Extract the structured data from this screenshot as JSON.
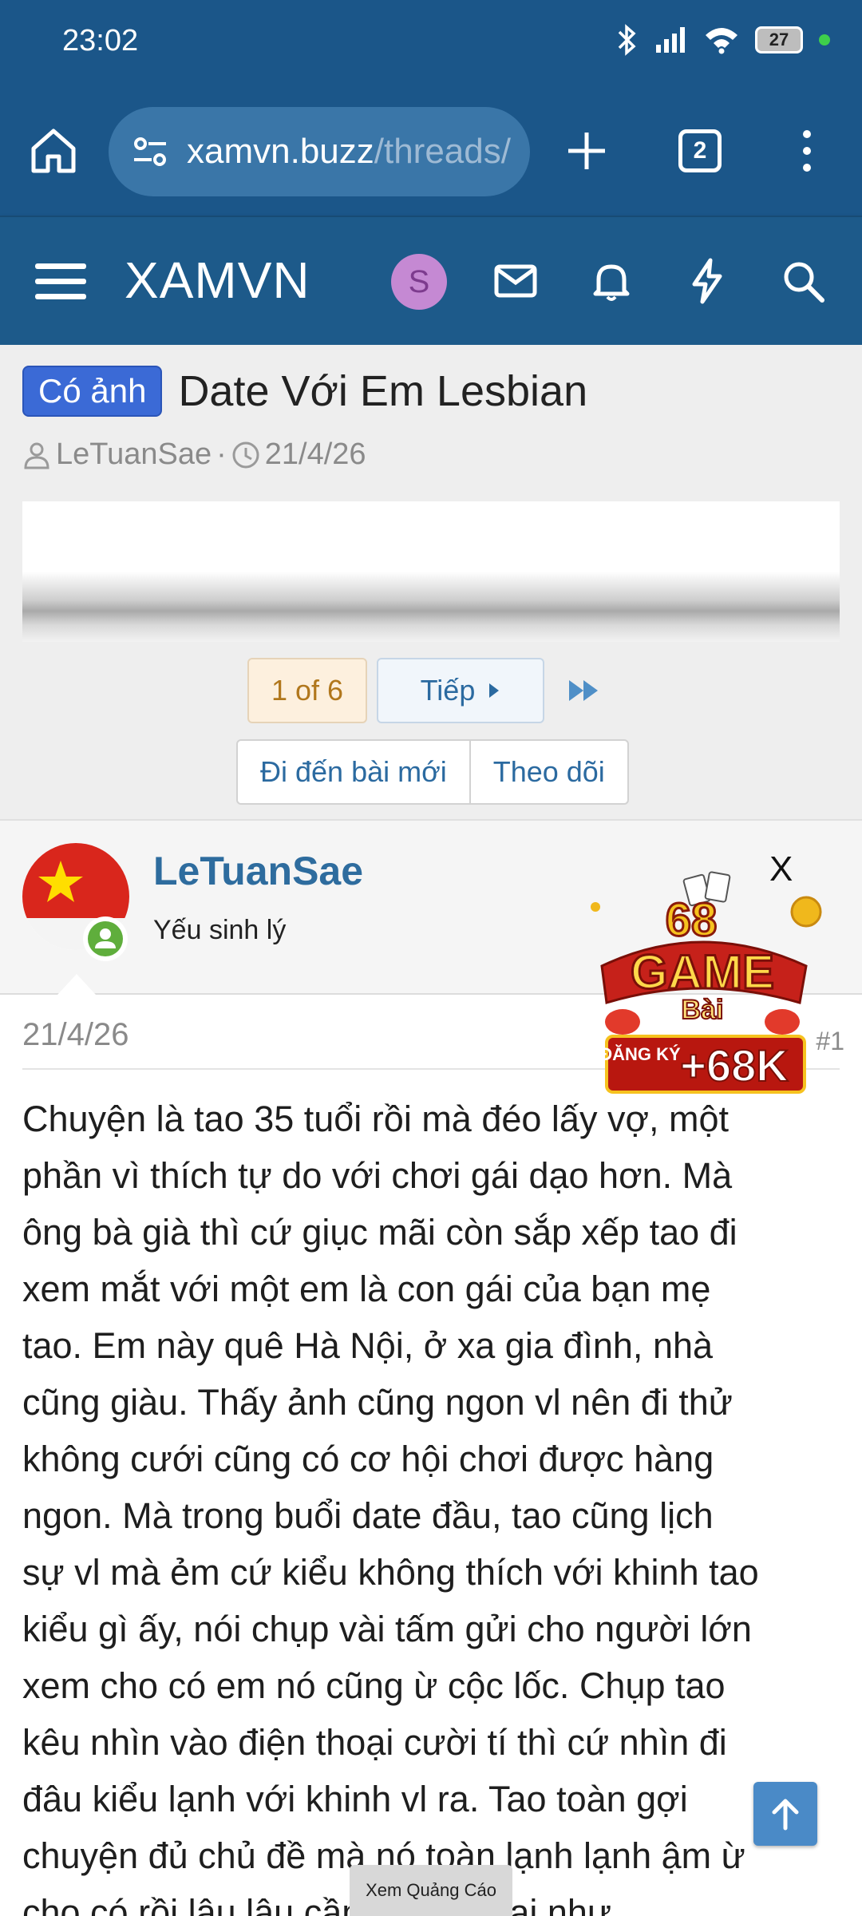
{
  "status_bar": {
    "time": "23:02",
    "battery": "27"
  },
  "browser": {
    "url_host": "xamvn.buzz",
    "url_path": "/threads/",
    "tab_count": "2"
  },
  "site": {
    "brand": "XAMVN",
    "user_initial": "S"
  },
  "thread": {
    "prefix": "Có ảnh",
    "title": "Date Với Em Lesbian",
    "author": "LeTuanSae",
    "date": "21/4/26",
    "pager": {
      "current": "1 of 6",
      "next": "Tiếp"
    },
    "actions": {
      "goto_new": "Đi đến bài mới",
      "follow": "Theo dõi"
    }
  },
  "post": {
    "username": "LeTuanSae",
    "user_title": "Yếu sinh lý",
    "date": "21/4/26",
    "number": "#1",
    "lines": [
      "Chuyện là tao 35 tuổi rồi mà đéo lấy vợ, một",
      "phần vì thích tự do với chơi gái dạo hơn. Mà",
      "ông bà già thì cứ giục mãi còn sắp xếp tao đi",
      "xem mắt với một em là con gái của bạn mẹ",
      "tao. Em này quê Hà Nội, ở xa gia đình, nhà",
      "cũng giàu. Thấy ảnh cũng ngon vl nên đi thử",
      "không cưới cũng có cơ hội chơi được hàng",
      "ngon. Mà trong buổi date đầu, tao cũng lịch",
      "sự vl mà ẻm cứ kiểu không thích với khinh tao",
      "kiểu gì ấy, nói chụp vài tấm gửi cho người lớn",
      "xem cho có em nó cũng ừ cộc lốc. Chụp tao",
      "kêu nhìn vào điện thoại cười tí thì cứ nhìn đi",
      "đâu kiểu lạnh với khinh vl ra. Tao toàn gợi",
      "chuyện đủ chủ đề mà nó toàn lạnh lạnh ậm ừ",
      "cho có rồi lâu lâu cầm điện thoại như"
    ]
  },
  "ad": {
    "close": "X",
    "brand_top": "68",
    "brand_mid": "GAME",
    "brand_sub": "Bài",
    "cta_small": "ĐĂNG KÝ",
    "cta_big": "+68K",
    "view_ad": "Xem Quảng Cáo"
  }
}
